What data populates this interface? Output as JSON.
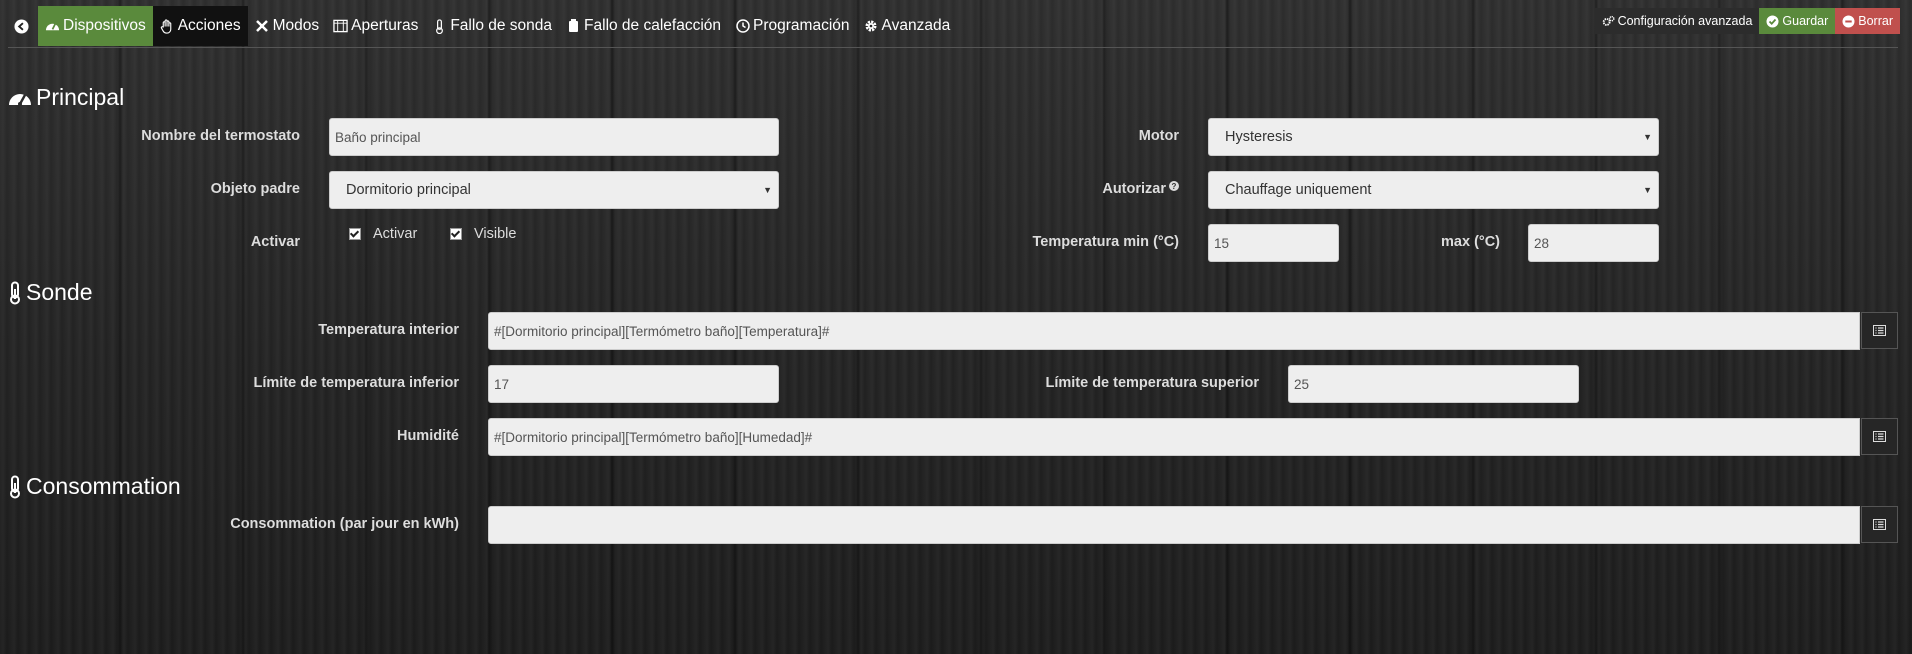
{
  "nav": {
    "items": [
      {
        "label": "Dispositivos",
        "icon": "tachometer-icon"
      },
      {
        "label": "Acciones",
        "icon": "hand-icon"
      },
      {
        "label": "Modos",
        "icon": "modes-icon"
      },
      {
        "label": "Aperturas",
        "icon": "window-icon"
      },
      {
        "label": "Fallo de sonda",
        "icon": "thermometer-icon"
      },
      {
        "label": "Fallo de calefacción",
        "icon": "heater-icon"
      },
      {
        "label": "Programación",
        "icon": "clock-icon"
      },
      {
        "label": "Avanzada",
        "icon": "cog-icon"
      }
    ]
  },
  "toolbar": {
    "advanced_label": "Configuración avanzada",
    "save_label": "Guardar",
    "delete_label": "Borrar"
  },
  "principal": {
    "title": "Principal",
    "name_label": "Nombre del termostato",
    "name_value": "Baño principal",
    "parent_label": "Objeto padre",
    "parent_value": "Dormitorio principal",
    "activate_label": "Activar",
    "cb_activate": "Activar",
    "cb_visible": "Visible",
    "engine_label": "Motor",
    "engine_value": "Hysteresis",
    "authorize_label": "Autorizar",
    "authorize_value": "Chauffage uniquement",
    "tmin_label": "Temperatura min (°C)",
    "tmin_value": "15",
    "tmax_label": "max (°C)",
    "tmax_value": "28"
  },
  "sonde": {
    "title": "Sonde",
    "indoor_label": "Temperatura interior",
    "indoor_value": "#[Dormitorio principal][Termómetro baño][Temperatura]#",
    "lower_label": "Límite de temperatura inferior",
    "lower_value": "17",
    "upper_label": "Límite de temperatura superior",
    "upper_value": "25",
    "humidity_label": "Humidité",
    "humidity_value": "#[Dormitorio principal][Termómetro baño][Humedad]#"
  },
  "consommation": {
    "title": "Consommation",
    "label": "Consommation (par jour en kWh)",
    "value": ""
  },
  "colors": {
    "green": "#5a8a3c",
    "red": "#c0504d"
  }
}
